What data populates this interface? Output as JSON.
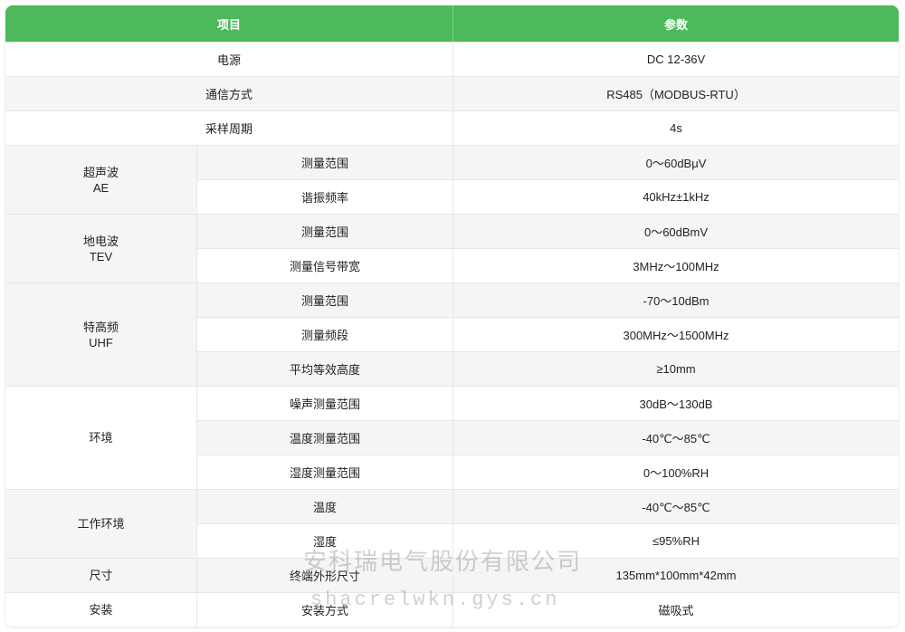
{
  "table": {
    "header": {
      "item": "项目",
      "param": "参数"
    },
    "rows": [
      {
        "label": "电源",
        "value": "DC 12-36V"
      },
      {
        "label": "通信方式",
        "value": "RS485（MODBUS-RTU）"
      },
      {
        "label": "采样周期",
        "value": "4s"
      },
      {
        "group": "超声波\nAE",
        "sub": "测量范围",
        "value": "0～60dBμV"
      },
      {
        "sub": "谐振频率",
        "value": "40kHz±1kHz"
      },
      {
        "group": "地电波\nTEV",
        "sub": "测量范围",
        "value": "0～60dBmV"
      },
      {
        "sub": "测量信号带宽",
        "value": "3MHz～100MHz"
      },
      {
        "group": "特高频\nUHF",
        "sub": "测量范围",
        "value": "-70～10dBm"
      },
      {
        "sub": "测量频段",
        "value": "300MHz～1500MHz"
      },
      {
        "sub": "平均等效高度",
        "value": "≥10mm"
      },
      {
        "group": "环境",
        "sub": "噪声测量范围",
        "value": "30dB～130dB"
      },
      {
        "sub": "温度测量范围",
        "value": "-40℃～85℃"
      },
      {
        "sub": "湿度测量范围",
        "value": "0～100%RH"
      },
      {
        "group": "工作环境",
        "sub": "温度",
        "value": "-40℃～85℃"
      },
      {
        "sub": "湿度",
        "value": "≤95%RH"
      },
      {
        "group": "尺寸",
        "sub": "终端外形尺寸",
        "value": "135mm*100mm*42mm"
      },
      {
        "group": "安装",
        "sub": "安装方式",
        "value": "磁吸式"
      }
    ]
  },
  "watermark": {
    "company": "安科瑞电气股份有限公司",
    "site": "shacrelwkn.gys.cn"
  },
  "colors": {
    "header_bg": "#4cba5a",
    "header_text": "#ffffff",
    "stripe": "#f5f5f5"
  }
}
